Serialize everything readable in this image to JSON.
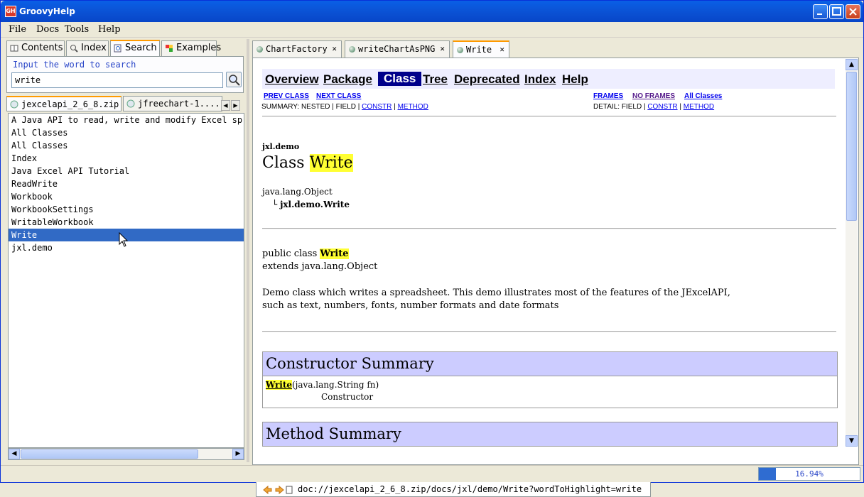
{
  "window": {
    "title": "GroovyHelp",
    "icon_text": "GH"
  },
  "menu": [
    "File",
    "Docs",
    "Tools",
    "Help"
  ],
  "left": {
    "tabs": [
      "Contents",
      "Index",
      "Search",
      "Examples"
    ],
    "search_label": "Input the word to search",
    "search_value": "write",
    "doc_tabs": [
      "jexcelapi_2_6_8.zip",
      "jfreechart-1...."
    ],
    "results": [
      "A Java API to read, write and modify Excel spre",
      "All Classes",
      "All Classes",
      "Index",
      "Java Excel API Tutorial",
      "ReadWrite",
      "Workbook",
      "WorkbookSettings",
      "WritableWorkbook",
      "Write",
      "jxl.demo"
    ],
    "selected_index": 9
  },
  "right": {
    "tabs": [
      "ChartFactory",
      "writeChartAsPNG",
      "Write"
    ],
    "nav": {
      "links": [
        "Overview",
        "Package",
        "Class",
        "Tree",
        "Deprecated",
        "Index",
        "Help"
      ],
      "current": "Class",
      "prev_class": "PREV CLASS",
      "next_class": "NEXT CLASS",
      "frames": "FRAMES",
      "no_frames": "NO FRAMES",
      "all_classes": "All Classes",
      "summary_prefix": "SUMMARY: NESTED | FIELD |",
      "detail_prefix": "DETAIL: FIELD |",
      "constr": "CONSTR",
      "method": "METHOD",
      "sep": "|"
    },
    "package": "jxl.demo",
    "class_prefix": "Class",
    "class_name": "Write",
    "hierarchy_root": "java.lang.Object",
    "hierarchy_child": "jxl.demo.Write",
    "hierarchy_glyph": "└",
    "decl_prefix": "public class",
    "decl_extends": "extends java.lang.Object",
    "description_line1": "Demo class which writes a spreadsheet. This demo illustrates most of the features of the JExcelAPI,",
    "description_line2": "such as text, numbers, fonts, number formats and date formats",
    "constructor_summary_title": "Constructor Summary",
    "constructor_sig_rest": "(java.lang.String fn)",
    "constructor_desc": "Constructor",
    "method_summary_title": "Method Summary",
    "status_url": "doc://jexcelapi_2_6_8.zip/docs/jxl/demo/Write?wordToHighlight=write"
  },
  "progress": {
    "text": "16.94%",
    "value": 16.94
  },
  "colors": {
    "titlebar": "#0a5fe6",
    "highlight": "#ffff33",
    "selection": "#316ac5",
    "nav_current": "#00008b",
    "summary_head": "#ccccff"
  }
}
